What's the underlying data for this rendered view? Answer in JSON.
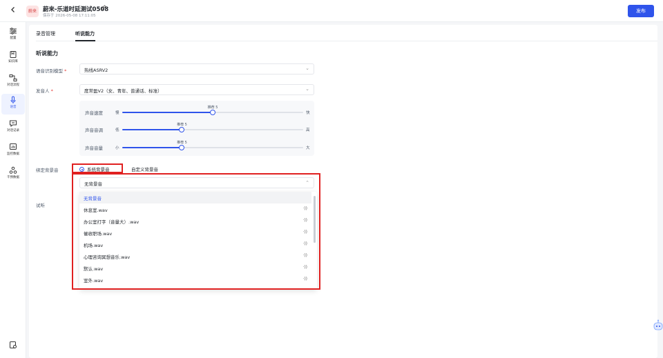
{
  "header": {
    "avatar_text": "蔚来",
    "title": "蔚来-乐道时延测试0508",
    "saved_at": "保存于 2026-05-08 17:11:05",
    "publish_label": "发布"
  },
  "sidebar": {
    "items": [
      {
        "label": "配置",
        "icon": "sliders-icon"
      },
      {
        "label": "知识库",
        "icon": "book-icon"
      },
      {
        "label": "对话流程",
        "icon": "flow-icon"
      },
      {
        "label": "语音",
        "icon": "microphone-icon",
        "active": true
      },
      {
        "label": "对话记录",
        "icon": "chat-record-icon"
      },
      {
        "label": "监控数据",
        "icon": "monitor-chart-icon"
      },
      {
        "label": "干预数据",
        "icon": "intervention-icon"
      }
    ]
  },
  "tabs": [
    {
      "label": "录音管理",
      "active": false
    },
    {
      "label": "听说能力",
      "active": true
    }
  ],
  "section_title": "听说能力",
  "asr": {
    "label": "语音识别模型",
    "required": "*",
    "value": "热线ASRV2"
  },
  "speaker": {
    "label": "发音人",
    "required": "*",
    "value": "度常盈V2（女、青年、普通话、标准）"
  },
  "sliders": [
    {
      "label": "声音速度",
      "min_label": "慢",
      "max_label": "快",
      "tip": "推荐 5",
      "level": 0.5
    },
    {
      "label": "声音音调",
      "min_label": "低",
      "max_label": "高",
      "tip": "推荐 5",
      "level": 0.33
    },
    {
      "label": "声音音量",
      "min_label": "小",
      "max_label": "大",
      "tip": "推荐 5",
      "level": 0.33
    }
  ],
  "background": {
    "label": "绑定背景音",
    "radios": [
      {
        "label": "系统背景音",
        "checked": true
      },
      {
        "label": "自定义背景音",
        "checked": false
      }
    ],
    "select_value": "无背景音",
    "options": [
      {
        "label": "无背景音",
        "selected": true
      },
      {
        "label": "休息室.wav"
      },
      {
        "label": "办公室打字（音量大）.wav"
      },
      {
        "label": "催收职场.wav"
      },
      {
        "label": "机场.wav"
      },
      {
        "label": "心理咨询冥想音乐.wav"
      },
      {
        "label": "默认.wav"
      },
      {
        "label": "室外.wav"
      }
    ]
  },
  "preview_label": "试听",
  "colors": {
    "accent": "#2f54eb",
    "highlight": "#e02020"
  }
}
